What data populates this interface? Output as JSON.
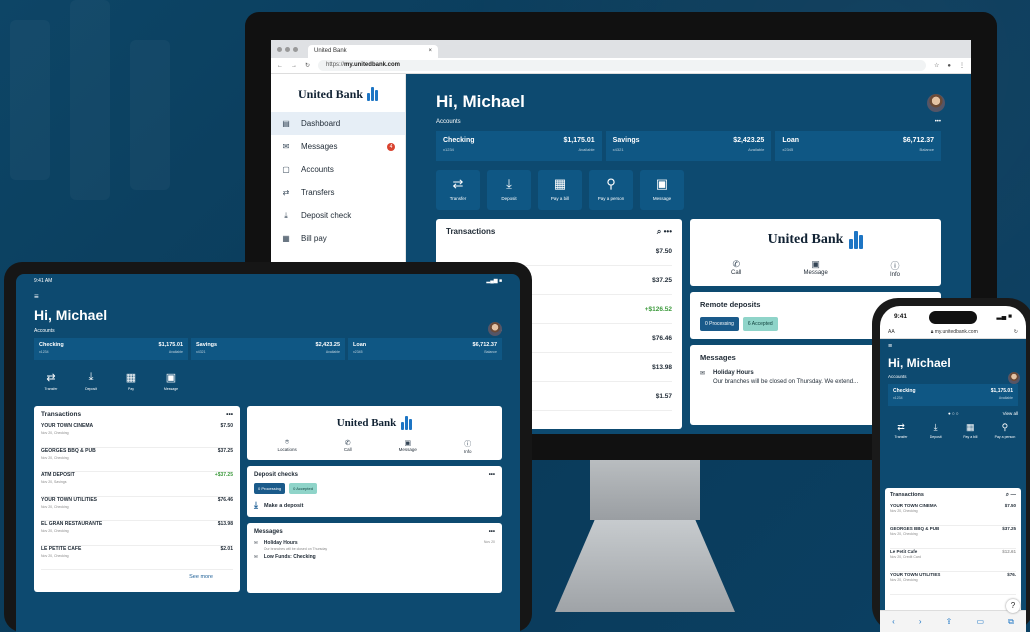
{
  "desktop": {
    "browser": {
      "tab_title": "United Bank",
      "url_prefix": "https://",
      "url_host": "my.unitedbank.com"
    },
    "brand": "United Bank",
    "nav": [
      {
        "label": "Dashboard",
        "icon": "dashboard-icon"
      },
      {
        "label": "Messages",
        "icon": "mail-icon",
        "badge": "4"
      },
      {
        "label": "Accounts",
        "icon": "accounts-icon"
      },
      {
        "label": "Transfers",
        "icon": "transfer-icon"
      },
      {
        "label": "Deposit check",
        "icon": "deposit-icon"
      },
      {
        "label": "Bill pay",
        "icon": "bill-icon"
      }
    ],
    "greeting": "Hi, Michael",
    "accounts_label": "Accounts",
    "accounts": [
      {
        "name": "Checking",
        "num": "x1234",
        "amount": "$1,175.01",
        "sub": "Available"
      },
      {
        "name": "Savings",
        "num": "x4321",
        "amount": "$2,423.25",
        "sub": "Available"
      },
      {
        "name": "Loan",
        "num": "x2345",
        "amount": "$6,712.37",
        "sub": "Balance"
      }
    ],
    "actions": [
      "Transfer",
      "Deposit",
      "Pay a bill",
      "Pay a person",
      "Message"
    ],
    "transactions_title": "Transactions",
    "transactions": [
      {
        "amount": "$7.50",
        "credit": false
      },
      {
        "amount": "$37.25",
        "credit": false
      },
      {
        "amount": "+$126.52",
        "credit": true
      },
      {
        "amount": "$76.46",
        "credit": false
      },
      {
        "amount": "$13.98",
        "credit": false
      },
      {
        "amount": "$1.57",
        "credit": false
      }
    ],
    "quick": [
      "Call",
      "Message",
      "Info"
    ],
    "remote_title": "Remote deposits",
    "pill_processing": "0 Processing",
    "pill_accepted": "6 Accepted",
    "messages_title": "Messages",
    "message": {
      "title": "Holiday Hours",
      "body": "Our branches will be closed on Thursday. We extend..."
    }
  },
  "tablet": {
    "time": "9:41 AM",
    "greeting": "Hi, Michael",
    "accounts_label": "Accounts",
    "accounts": [
      {
        "name": "Checking",
        "num": "x1234",
        "amount": "$1,175.01",
        "sub": "Available"
      },
      {
        "name": "Savings",
        "num": "x4321",
        "amount": "$2,423.25",
        "sub": "Available"
      },
      {
        "name": "Loan",
        "num": "x2345",
        "amount": "$6,712.37",
        "sub": "Balance"
      }
    ],
    "actions": [
      "Transfer",
      "Deposit",
      "Pay",
      "Message"
    ],
    "transactions_title": "Transactions",
    "transactions": [
      {
        "name": "YOUR TOWN CINEMA",
        "sub": "Nov 20, Checking",
        "amount": "$7.50",
        "credit": false
      },
      {
        "name": "GEORGES BBQ & PUB",
        "sub": "Nov 20, Checking",
        "amount": "$37.25",
        "credit": false
      },
      {
        "name": "ATM DEPOSIT",
        "sub": "Nov 20, Savings",
        "amount": "+$37.25",
        "credit": true
      },
      {
        "name": "YOUR TOWN UTILITIES",
        "sub": "Nov 20, Checking",
        "amount": "$76.46",
        "credit": false
      },
      {
        "name": "EL GRAN RESTAURANTE",
        "sub": "Nov 20, Checking",
        "amount": "$13.98",
        "credit": false
      },
      {
        "name": "LE PETITE CAFE",
        "sub": "Nov 20, Checking",
        "amount": "$2.01",
        "credit": false
      }
    ],
    "see_more": "See more",
    "brand": "United Bank",
    "quick": [
      "Locations",
      "Call",
      "Message",
      "Info"
    ],
    "deposit_title": "Deposit checks",
    "pill_processing": "0 Processing",
    "pill_accepted": "0 Accepted",
    "make_deposit": "Make a deposit",
    "messages_title": "Messages",
    "messages": [
      {
        "title": "Holiday Hours",
        "body": "Our branches will be closed on Thursday",
        "date": "Nov 20"
      },
      {
        "title": "Low Funds: Checking",
        "body": "",
        "date": ""
      }
    ]
  },
  "phone": {
    "time": "9:41",
    "aa": "AA",
    "url": "my.unitedbank.com",
    "greeting": "Hi, Michael",
    "accounts_label": "Accounts",
    "account": {
      "name": "Checking",
      "num": "x1234",
      "amount": "$1,175.01",
      "sub": "Available"
    },
    "view_all": "View all",
    "actions": [
      "Transfer",
      "Deposit",
      "Pay a bill",
      "Pay a person"
    ],
    "transactions_title": "Transactions",
    "transactions": [
      {
        "name": "YOUR TOWN CINEMA",
        "sub": "Nov 20, Checking",
        "amount": "$7.50"
      },
      {
        "name": "GEORGES BBQ & PUB",
        "sub": "Nov 20, Checking",
        "amount": "$37.25"
      },
      {
        "name": "Le Petit Cafe",
        "sub": "Nov 20, Credit Card",
        "amount": "$12.61"
      },
      {
        "name": "YOUR TOWN UTILITIES",
        "sub": "Nov 20, Checking",
        "amount": "$76."
      }
    ],
    "help": "?"
  }
}
